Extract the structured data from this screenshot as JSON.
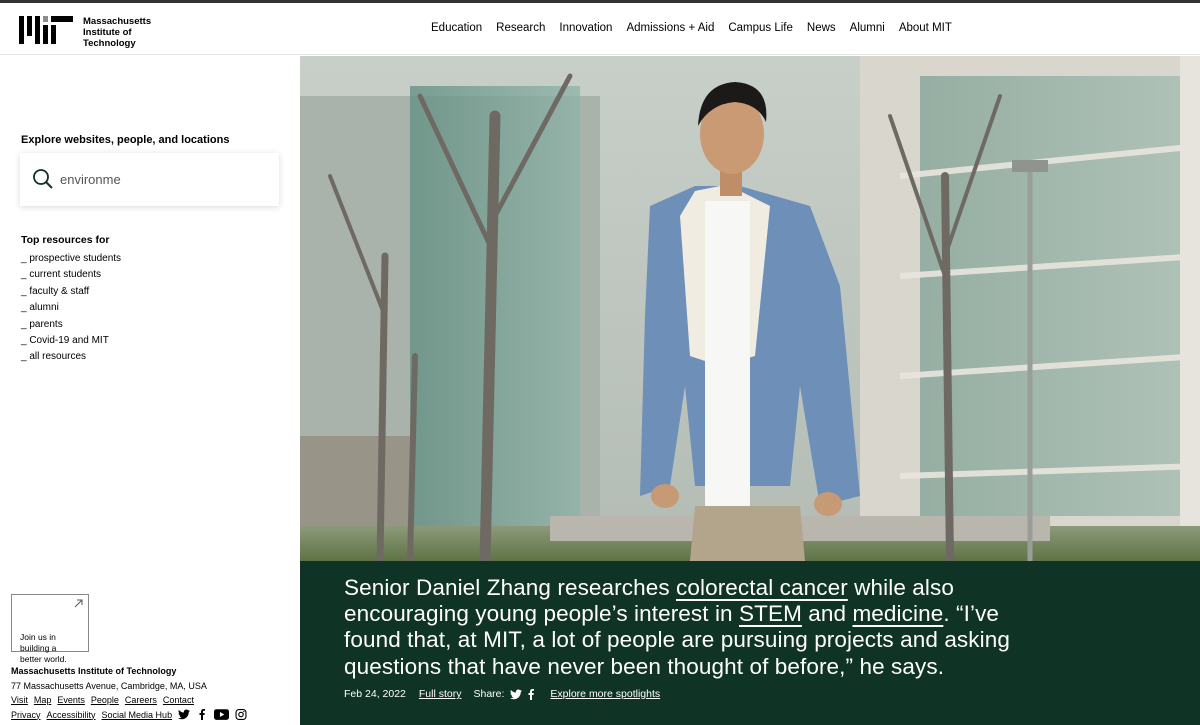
{
  "colors": {
    "caption_bg": "#0f3324",
    "top_bar": "#333333"
  },
  "logo": {
    "text": "Massachusetts\nInstitute of\nTechnology",
    "icon": "mit-logo-icon"
  },
  "nav": [
    "Education",
    "Research",
    "Innovation",
    "Admissions + Aid",
    "Campus Life",
    "News",
    "Alumni",
    "About MIT"
  ],
  "sidebar": {
    "explore_label": "Explore websites, people, and locations",
    "search": {
      "value": "environme",
      "icon": "search-icon"
    },
    "top_resources_title": "Top resources for",
    "resources": [
      "_ prospective students",
      "_ current students",
      "_ faculty & staff",
      "_ alumni",
      "_ parents",
      "_ Covid-19 and MIT",
      "_ all resources"
    ],
    "join": {
      "text": "Join us in\nbuilding a\nbetter world.",
      "icon": "arrow-up-right-icon"
    }
  },
  "footer": {
    "name": "Massachusetts Institute of Technology",
    "address": "77 Massachusetts Avenue, Cambridge, MA, USA",
    "links_row1": [
      "Visit",
      "Map",
      "Events",
      "People",
      "Careers",
      "Contact"
    ],
    "links_row2": [
      "Privacy",
      "Accessibility",
      "Social Media Hub"
    ],
    "social_icons": [
      "twitter-icon",
      "facebook-icon",
      "youtube-icon",
      "instagram-icon"
    ]
  },
  "hero": {
    "caption": {
      "part1": "Senior Daniel Zhang researches ",
      "link1": "colorectal cancer",
      "part2": " while also encouraging young people’s interest in ",
      "link2": "STEM",
      "part3": " and ",
      "link3": "medicine",
      "part4": ". “I’ve found that, at MIT, a lot of people are pursuing projects and asking questions that have never been thought of before,” he says."
    },
    "date": "Feb 24, 2022",
    "full_story": "Full story",
    "share_label": "Share:",
    "explore_more": "Explore more spotlights"
  }
}
